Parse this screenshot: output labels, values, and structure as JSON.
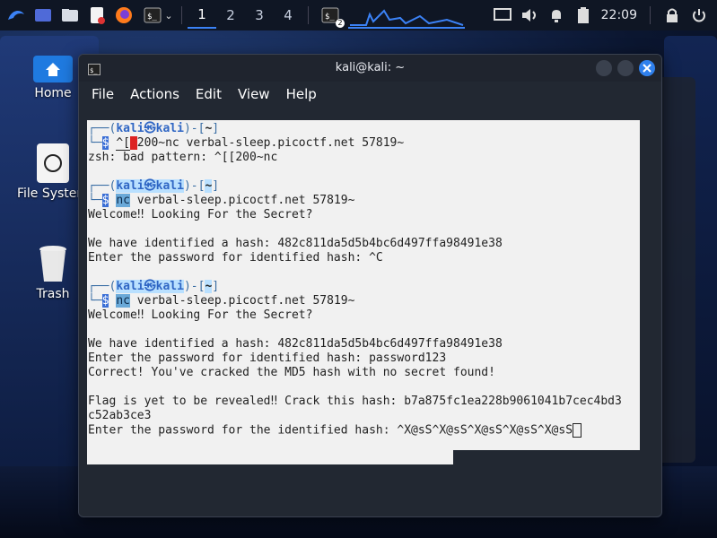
{
  "taskbar": {
    "workspaces": [
      "1",
      "2",
      "3",
      "4"
    ],
    "active_workspace": "1",
    "clock": "22:09",
    "taskbar_badge": "2"
  },
  "desktop": {
    "home_label": "Home",
    "filesystem_label": "File System",
    "trash_label": "Trash"
  },
  "window": {
    "title": "kali@kali: ~",
    "menu": [
      "File",
      "Actions",
      "Edit",
      "View",
      "Help"
    ]
  },
  "terminal": {
    "prompt_user": "kali",
    "prompt_host": "kali",
    "prompt_at": "㉿",
    "prompt_dir": "~",
    "bad_cmd": "^[[200~nc verbal-sleep.picoctf.net 57819~",
    "bad_cmd_rest": "200~nc verbal-sleep.picoctf.net 57819~",
    "zsh_error": "zsh: bad pattern: ^[[200~nc",
    "cmd_nc": "nc",
    "cmd_args": " verbal-sleep.picoctf.net 57819~",
    "welcome": "Welcome‼ Looking For the Secret?",
    "identified": "We have identified a hash: 482c811da5d5b4bc6d497ffa98491e38",
    "enter_pw_interrupt": "Enter the password for identified hash: ^C",
    "enter_pw": "Enter the password for identified hash: password123",
    "correct": "Correct! You've cracked the MD5 hash with no secret found!",
    "flag_line": "Flag is yet to be revealed‼ Crack this hash: b7a875fc1ea228b9061041b7cec4bd3",
    "flag_line_2": "c52ab3ce3",
    "enter_pw_final": "Enter the password for the identified hash: ^X@sS^X@sS^X@sS^X@sS^X@sS"
  },
  "colors": {
    "accent": "#3b82f6",
    "terminal_bg": "#f1f1f1"
  }
}
